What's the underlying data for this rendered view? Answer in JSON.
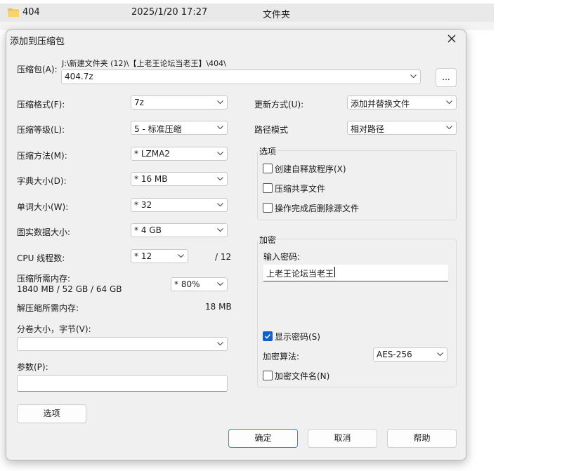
{
  "background": {
    "file_name": "404",
    "modified": "2025/1/20 17:27",
    "type": "文件夹"
  },
  "dialog": {
    "title": "添加到压缩包",
    "archive_label": "压缩包(A):",
    "archive_path": "J:\\新建文件夹 (12)\\【上老王论坛当老王】\\404\\",
    "archive_name": "404.7z",
    "browse_label": "...",
    "left": {
      "format_label": "压缩格式(F):",
      "format_value": "7z",
      "level_label": "压缩等级(L):",
      "level_value": "5 - 标准压缩",
      "method_label": "压缩方法(M):",
      "method_value": "* LZMA2",
      "dict_label": "字典大小(D):",
      "dict_value": "* 16 MB",
      "word_label": "单词大小(W):",
      "word_value": "* 32",
      "solid_label": "固实数据大小:",
      "solid_value": "* 4 GB",
      "threads_label": "CPU 线程数:",
      "threads_value": "* 12",
      "threads_max": "/ 12",
      "mem_label": "压缩所需内存:",
      "mem_detail": "1840 MB / 52 GB / 64 GB",
      "mem_value": "* 80%",
      "decomp_label": "解压缩所需内存:",
      "decomp_value": "18 MB",
      "split_label": "分卷大小，字节(V):",
      "split_value": "",
      "params_label": "参数(P):",
      "params_value": "",
      "options_button": "选项"
    },
    "right": {
      "update_label": "更新方式(U):",
      "update_value": "添加并替换文件",
      "path_label": "路径模式",
      "path_value": "相对路径",
      "options_group": "选项",
      "opt_sfx": "创建自释放程序(X)",
      "opt_shared": "压缩共享文件",
      "opt_delete": "操作完成后删除源文件",
      "encrypt_group": "加密",
      "enter_password_label": "输入密码:",
      "password_value": "上老王论坛当老王",
      "show_password": "显示密码(S)",
      "enc_method_label": "加密算法:",
      "enc_method_value": "AES-256",
      "encrypt_names": "加密文件名(N)"
    },
    "buttons": {
      "ok": "确定",
      "cancel": "取消",
      "help": "帮助"
    },
    "checks": {
      "sfx": false,
      "shared": false,
      "delete": false,
      "show_password": true,
      "encrypt_names": false
    }
  },
  "colors": {
    "accent": "#0f62c8",
    "dialog_bg": "#f0f0f0",
    "row_bg": "#e9e9e9"
  }
}
